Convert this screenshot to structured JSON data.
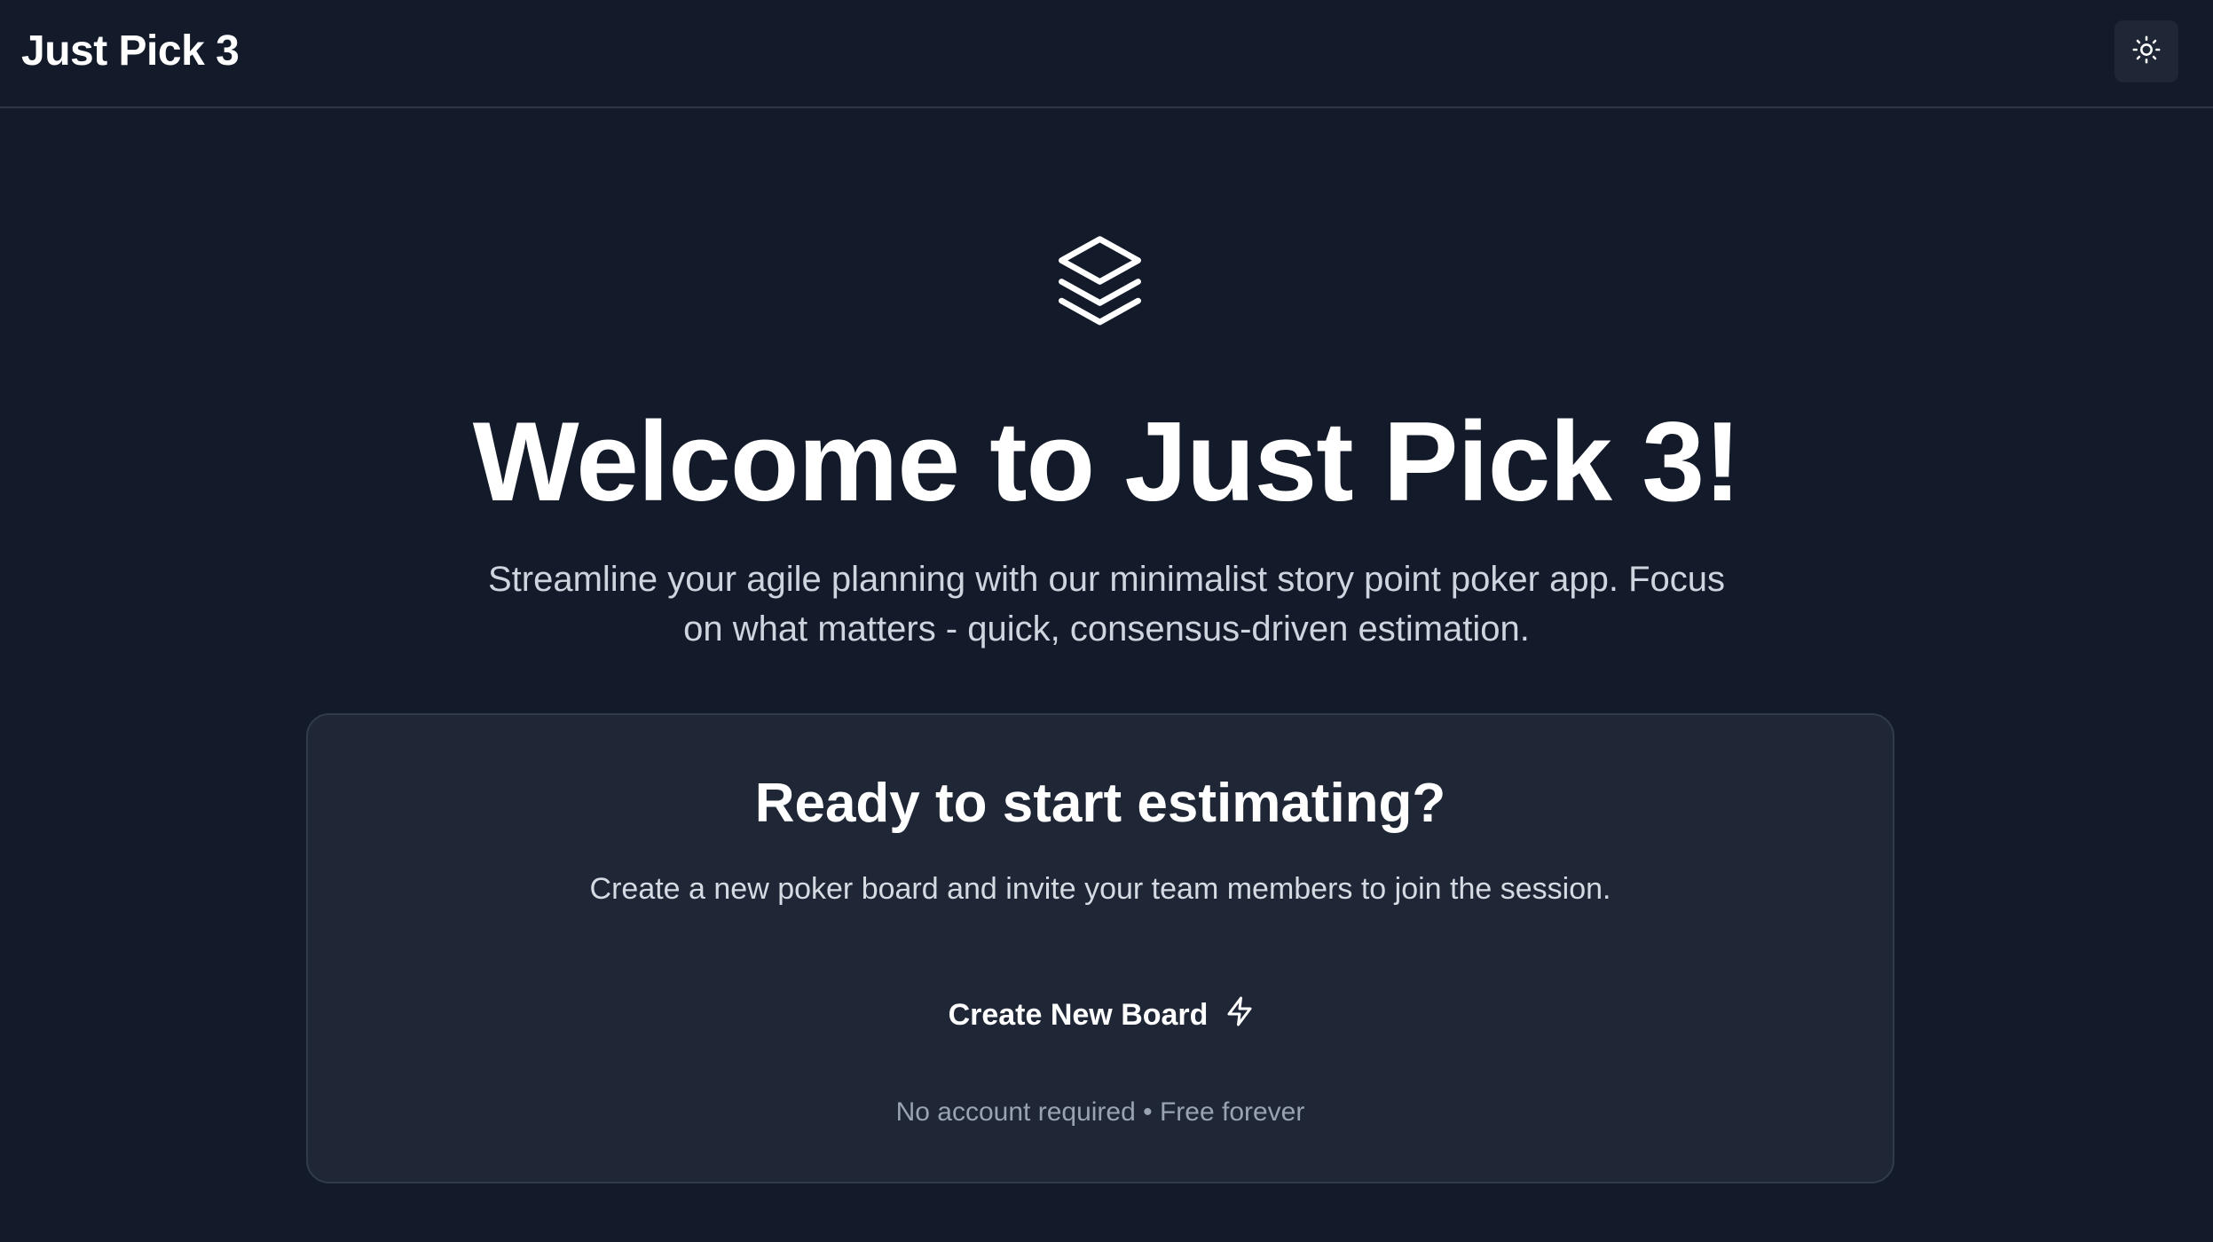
{
  "header": {
    "brand": "Just Pick 3",
    "theme_toggle_icon": "sun-icon"
  },
  "hero": {
    "logo_icon": "layers-icon",
    "title": "Welcome to Just Pick 3!",
    "subtitle": "Streamline your agile planning with our minimalist story point poker app. Focus on what matters - quick, consensus-driven estimation."
  },
  "card": {
    "title": "Ready to start estimating?",
    "description": "Create a new poker board and invite your team members to join the session.",
    "button_label": "Create New Board",
    "button_icon": "lightning-icon",
    "footnote": "No account required • Free forever"
  },
  "colors": {
    "background": "#131a29",
    "card_background": "#1f2737",
    "text_primary": "#ffffff",
    "text_muted": "#9aa3b2"
  }
}
